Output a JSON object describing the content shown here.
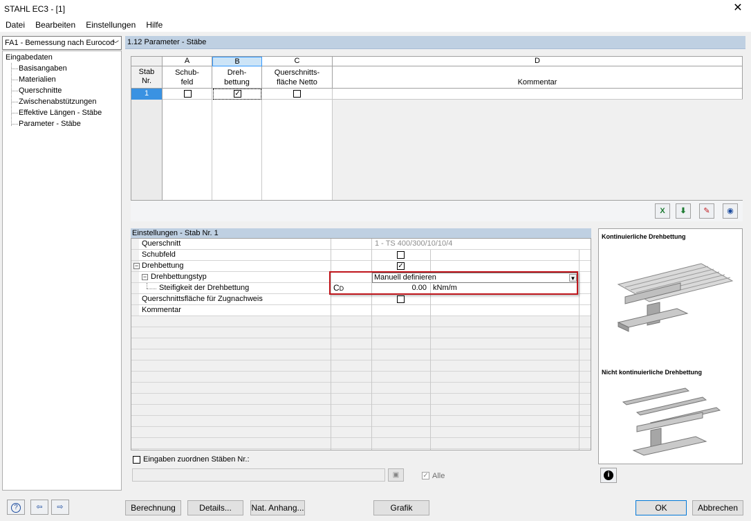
{
  "window": {
    "title": "STAHL EC3 - [1]",
    "close_glyph": "✕"
  },
  "menu": [
    "Datei",
    "Bearbeiten",
    "Einstellungen",
    "Hilfe"
  ],
  "case_select": {
    "value": "FA1 - Bemessung nach Eurocod"
  },
  "tree": {
    "root": "Eingabedaten",
    "items": [
      "Basisangaben",
      "Materialien",
      "Querschnitte",
      "Zwischenabstützungen",
      "Effektive Längen - Stäbe",
      "Parameter - Stäbe"
    ],
    "selected": "Parameter - Stäbe"
  },
  "section_title": "1.12 Parameter - Stäbe",
  "grid": {
    "col_letters": [
      "A",
      "B",
      "C",
      "D"
    ],
    "row_header": {
      "line1": "Stab",
      "line2": "Nr."
    },
    "col_headers": [
      {
        "line1": "Schub-",
        "line2": "feld"
      },
      {
        "line1": "Dreh-",
        "line2": "bettung"
      },
      {
        "line1": "Querschnitts-",
        "line2": "fläche Netto"
      },
      {
        "line1": "",
        "line2": "Kommentar"
      }
    ],
    "rows": [
      {
        "nr": "1",
        "schubfeld": false,
        "drehbettung": true,
        "netto": false,
        "kommentar": ""
      }
    ]
  },
  "settings": {
    "title": "Einstellungen - Stab Nr. 1",
    "rows": {
      "querschnitt": {
        "label": "Querschnitt",
        "value": "1 - TS 400/300/10/10/4"
      },
      "schubfeld": {
        "label": "Schubfeld",
        "checked": false
      },
      "drehbettung": {
        "label": "Drehbettung",
        "checked": true
      },
      "drehbettungstyp": {
        "label": "Drehbettungstyp",
        "value": "Manuell definieren"
      },
      "steifigkeit": {
        "label": "Steifigkeit der Drehbettung",
        "symbol": "C",
        "symbol_sub": "D",
        "value": "0.00",
        "unit": "kNm/m"
      },
      "zugnachweis": {
        "label": "Querschnittsfläche für Zugnachweis",
        "checked": false
      },
      "kommentar": {
        "label": "Kommentar",
        "value": ""
      }
    },
    "assign_label": "Eingaben zuordnen Stäben Nr.:",
    "assign_value": "",
    "alle_label": "Alle"
  },
  "images": {
    "kontinuierlich": "Kontinuierliche Drehbettung",
    "nicht_kontinuierlich": "Nicht kontinuierliche Drehbettung"
  },
  "buttons": {
    "berechnung": "Berechnung",
    "details": "Details...",
    "anhang": "Nat. Anhang...",
    "grafik": "Grafik",
    "ok": "OK",
    "abbrechen": "Abbrechen"
  },
  "colors": {
    "accent": "#0078d7",
    "highlight_red": "#c0151b",
    "header_blue": "#bfd0e2"
  }
}
